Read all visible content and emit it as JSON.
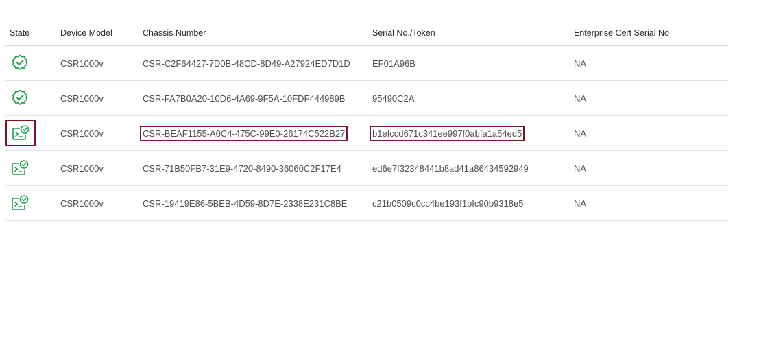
{
  "table": {
    "headers": {
      "state": "State",
      "device_model": "Device Model",
      "chassis_number": "Chassis Number",
      "serial_token": "Serial No./Token",
      "enterprise_cert": "Enterprise Cert Serial No"
    },
    "rows": [
      {
        "state_icon": "shield-check-icon",
        "device_model": "CSR1000v",
        "chassis_number": "CSR-C2F64427-7D0B-48CD-8D49-A27924ED7D1D",
        "serial_token": "EF01A96B",
        "enterprise_cert": "NA"
      },
      {
        "state_icon": "shield-check-icon",
        "device_model": "CSR1000v",
        "chassis_number": "CSR-FA7B0A20-10D6-4A69-9F5A-10FDF444989B",
        "serial_token": "95490C2A",
        "enterprise_cert": "NA"
      },
      {
        "state_icon": "terminal-check-icon",
        "device_model": "CSR1000v",
        "chassis_number": "CSR-BEAF1155-A0C4-475C-99E0-26174C522B27",
        "serial_token": "b1efccd671c341ee997f0abfa1a54ed5",
        "enterprise_cert": "NA"
      },
      {
        "state_icon": "terminal-check-icon",
        "device_model": "CSR1000v",
        "chassis_number": "CSR-71B50FB7-31E9-4720-8490-36060C2F17E4",
        "serial_token": "ed6e7f32348441b8ad41a86434592949",
        "enterprise_cert": "NA"
      },
      {
        "state_icon": "terminal-check-icon",
        "device_model": "CSR1000v",
        "chassis_number": "CSR-19419E86-5BEB-4D59-8D7E-2338E231C8BE",
        "serial_token": "c21b0509c0cc4be193f1bfc90b9318e5",
        "enterprise_cert": "NA"
      }
    ]
  },
  "colors": {
    "state_green": "#1a9e4b",
    "highlight_border": "#7a1426"
  }
}
